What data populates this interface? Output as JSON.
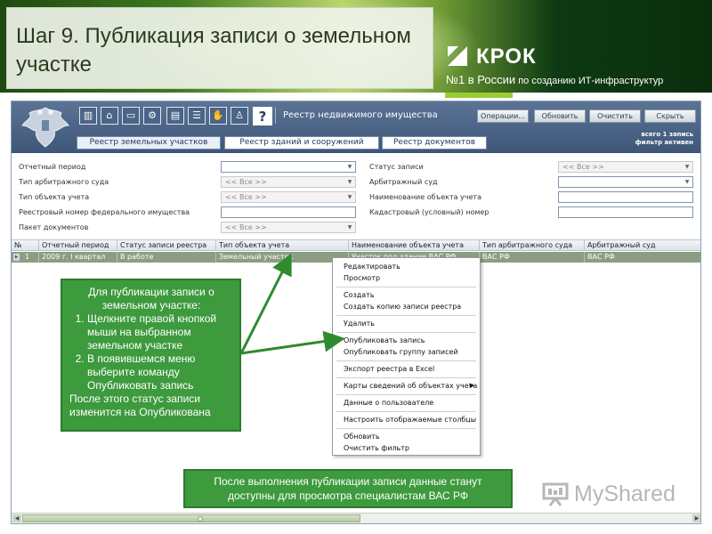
{
  "slide": {
    "title": "Шаг 9. Публикация записи о земельном участке",
    "brand": {
      "name": "КРОК",
      "tagline_lead": "№1 в России",
      "tagline_rest": " по созданию ИТ-инфраструктур"
    }
  },
  "app": {
    "title": "Реестр недвижимого имущества",
    "toolbar_icons": [
      "building-icon",
      "house-icon",
      "monitor-icon",
      "tractor-icon",
      "document-icon",
      "list-icon",
      "hand-icon",
      "person-icon",
      "help-icon"
    ],
    "help_label": "?",
    "header_buttons": [
      "Операции...",
      "Обновить",
      "Очистить",
      "Скрыть"
    ],
    "registry_tabs": [
      "Реестр земельных участков",
      "Реестр зданий и сооружений",
      "Реестр документов"
    ],
    "status": {
      "count": "всего 1 запись",
      "filter": "фильтр активен"
    }
  },
  "filters": {
    "left": [
      {
        "label": "Отчетный период",
        "value": "",
        "placeholder": ""
      },
      {
        "label": "Тип арбитражного суда",
        "value": "<< Все >>"
      },
      {
        "label": "Тип объекта учета",
        "value": "<< Все >>"
      },
      {
        "label": "Реестровый номер федерального имущества",
        "value": ""
      },
      {
        "label": "Пакет документов",
        "value": "<< Все >>"
      }
    ],
    "right": [
      {
        "label": "Статус записи",
        "value": "<< Все >>"
      },
      {
        "label": "Арбитражный суд",
        "value": ""
      },
      {
        "label": "Наименование объекта учета",
        "value": ""
      },
      {
        "label": "Кадастровый (условный) номер",
        "value": ""
      }
    ]
  },
  "table": {
    "columns": [
      "№",
      "Отчетный период",
      "Статус записи реестра",
      "Тип объекта учета",
      "Наименование объекта учета",
      "Тип арбитражного суда",
      "Арбитражный суд"
    ],
    "rows": [
      [
        "1",
        "2009 г. I квартал",
        "В работе",
        "Земельный участок",
        "Участок под здание ВАС РФ",
        "ВАС РФ",
        "ВАС РФ"
      ]
    ]
  },
  "context_menu": {
    "items": [
      "Редактировать",
      "Просмотр",
      "Создать",
      "Создать копию записи реестра",
      "Удалить",
      "Опубликовать запись",
      "Опубликовать группу записей",
      "Экспорт реестра в Excel",
      "Карты сведений об объектах учета",
      "Данные о пользователе",
      "Настроить отображаемые столбцы",
      "Обновить",
      "Очистить фильтр"
    ],
    "submenu_arrow": "▶"
  },
  "callouts": {
    "instructions": {
      "intro": "Для публикации записи о земельном участке:",
      "steps": [
        "Щелкните правой кнопкой мыши на выбранном земельном участке",
        "В появившемся меню выберите команду Опубликовать запись"
      ],
      "outro": "После этого статус записи изменится на Опубликована"
    },
    "result": "После выполнения публикации записи данные станут доступны для просмотра специалистам ВАС РФ"
  },
  "watermark": {
    "text": "MyShared"
  },
  "colors": {
    "callout_green": "#3d9a3d",
    "app_header": "#4b6487",
    "selected_row": "#8b9e83",
    "arrow_green": "#2e8b2e"
  }
}
